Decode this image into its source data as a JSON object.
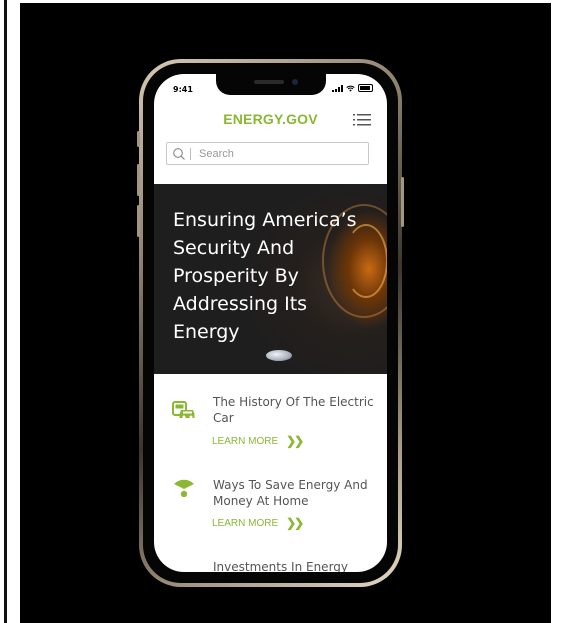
{
  "status_bar": {
    "time": "9:41"
  },
  "header": {
    "brand": "ENERGY.GOV"
  },
  "search": {
    "placeholder": "Search"
  },
  "hero": {
    "title": "Ensuring America’s Security And Prosperity By Addressing Its Energy"
  },
  "articles": [
    {
      "title": "The History Of The Electric Car",
      "link": "LEARN MORE",
      "icon": "electric-car-icon"
    },
    {
      "title": "Ways To Save Energy And Money At Home",
      "link": "LEARN MORE",
      "icon": "wifi-signal-icon"
    },
    {
      "title": "Investments In Energy",
      "icon": ""
    }
  ],
  "colors": {
    "brand_green": "#8ab833",
    "background": "#000000",
    "text_gray": "#555555"
  }
}
